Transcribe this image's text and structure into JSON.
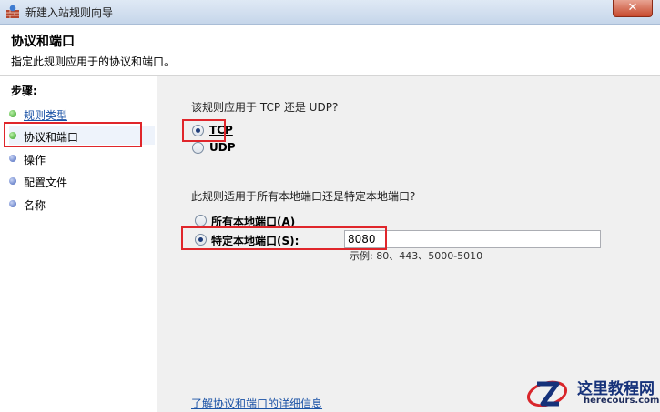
{
  "window": {
    "title": "新建入站规则向导",
    "close_label": "✕"
  },
  "header": {
    "title": "协议和端口",
    "description": "指定此规则应用于的协议和端口。"
  },
  "sidebar": {
    "steps_label": "步骤:",
    "items": [
      {
        "label": "规则类型",
        "status": "completed"
      },
      {
        "label": "协议和端口",
        "status": "current"
      },
      {
        "label": "操作",
        "status": "pending"
      },
      {
        "label": "配置文件",
        "status": "pending"
      },
      {
        "label": "名称",
        "status": "pending"
      }
    ]
  },
  "protocol": {
    "question": "该规则应用于 TCP 还是 UDP?",
    "options": [
      {
        "label": "TCP",
        "selected": true
      },
      {
        "label": "UDP",
        "selected": false
      }
    ]
  },
  "ports": {
    "question": "此规则适用于所有本地端口还是特定本地端口?",
    "options": [
      {
        "label": "所有本地端口(A)",
        "selected": false
      },
      {
        "label": "特定本地端口(S):",
        "selected": true
      }
    ],
    "value": "8080",
    "example": "示例: 80、443、5000-5010"
  },
  "help_link": "了解协议和端口的详细信息",
  "watermark": {
    "text": "这里教程网",
    "url": "herecours.com"
  },
  "colors": {
    "highlight": "#e0262b",
    "link": "#1a52a6"
  }
}
